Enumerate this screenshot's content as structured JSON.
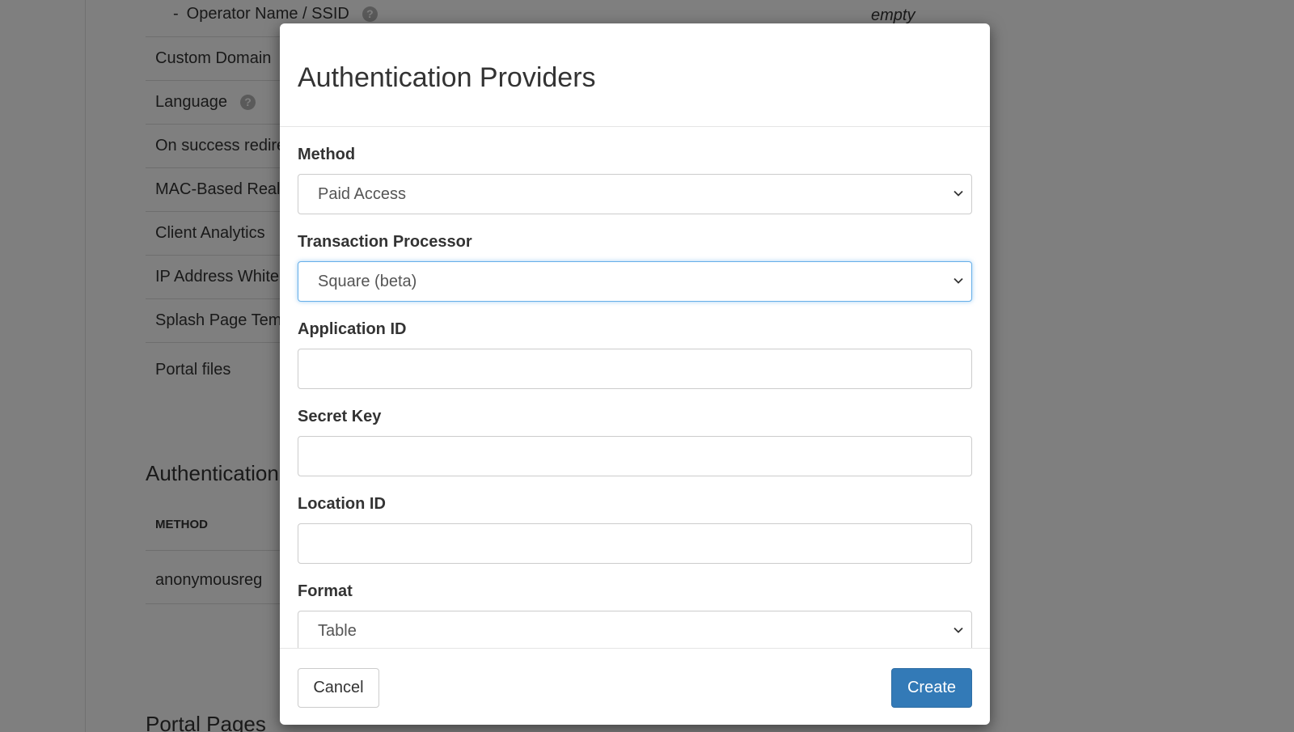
{
  "background": {
    "operator_row": {
      "prefix": "-",
      "label": "Operator Name / SSID",
      "value": "empty"
    },
    "rows": [
      "Custom Domain",
      "Language",
      "On success redirect",
      "MAC-Based Realm",
      "Client Analytics",
      "IP Address Whitelist",
      "Splash Page Template",
      "Portal files"
    ],
    "auth_heading": "Authentication Providers",
    "table_header_method": "METHOD",
    "table_cell_method": "anonymousreg",
    "portal_pages_heading": "Portal Pages"
  },
  "modal": {
    "title": "Authentication Providers",
    "fields": {
      "method": {
        "label": "Method",
        "value": "Paid Access"
      },
      "transaction_processor": {
        "label": "Transaction Processor",
        "value": "Square (beta)"
      },
      "application_id": {
        "label": "Application ID",
        "value": ""
      },
      "secret_key": {
        "label": "Secret Key",
        "value": ""
      },
      "location_id": {
        "label": "Location ID",
        "value": ""
      },
      "format": {
        "label": "Format",
        "value": "Table"
      }
    },
    "footer": {
      "cancel_label": "Cancel",
      "create_label": "Create"
    }
  },
  "colors": {
    "primary": "#337ab7",
    "focus_border": "#66afe9",
    "backdrop": "#000000"
  },
  "icons": {
    "help": "question-circle-icon",
    "select": "chevron-down-icon"
  }
}
